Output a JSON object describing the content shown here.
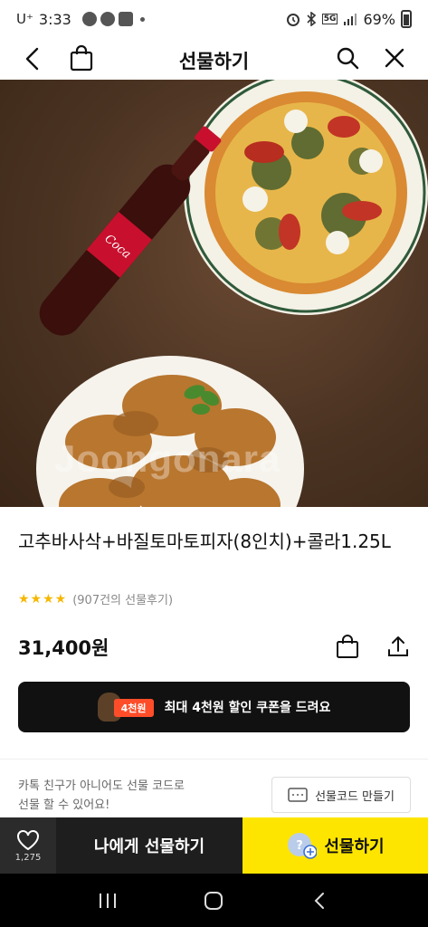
{
  "status_bar": {
    "carrier": "U⁺",
    "time": "3:33",
    "network": "5G",
    "battery_pct": "69%"
  },
  "header": {
    "title": "선물하기",
    "back_icon": "chevron-left-icon",
    "bag_icon": "shopping-bag-icon",
    "search_icon": "search-icon",
    "close_icon": "close-icon"
  },
  "hero": {
    "watermark": "Joongonara"
  },
  "product": {
    "name": "고추바사삭+바질토마토피자(8인치)+콜라1.25L",
    "stars": "★★★★",
    "reviews": "(907건의 선물후기)",
    "price": "31,400원"
  },
  "coupon": {
    "badge": "4천원",
    "text": "최대 4천원 할인 쿠폰을 드려요"
  },
  "gift_code": {
    "note_line1": "카톡 친구가 아니어도 선물 코드로",
    "note_line2": "선물 할 수 있어요!",
    "button": "선물코드 만들기"
  },
  "bottom_bar": {
    "like_count": "1,275",
    "self_gift": "나에게 선물하기",
    "gift": "선물하기"
  },
  "colors": {
    "accent_yellow": "#FEE500",
    "dark": "#1E1E1E",
    "star": "#F5B700",
    "coupon_tag": "#FF4D2A"
  }
}
